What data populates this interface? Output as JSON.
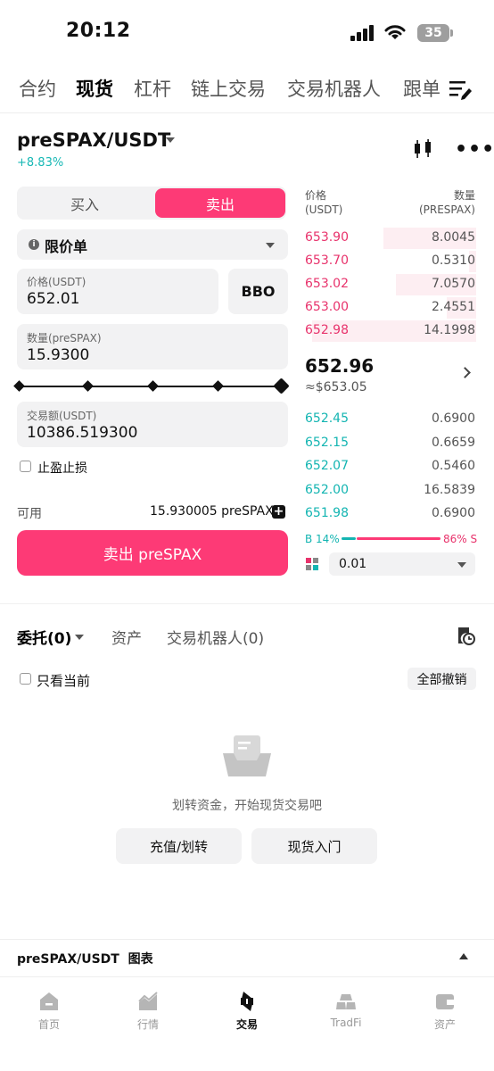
{
  "status": {
    "time": "20:12",
    "battery": "35"
  },
  "top_tabs": [
    "合约",
    "现货",
    "杠杆",
    "链上交易",
    "交易机器人",
    "跟单"
  ],
  "pair": {
    "name": "preSPAX/USDT",
    "change": "+8.83%"
  },
  "toggle": {
    "buy": "买入",
    "sell": "卖出"
  },
  "order_type": "限价单",
  "price_field": {
    "label": "价格(USDT)",
    "value": "652.01",
    "bbo": "BBO"
  },
  "qty_field": {
    "label": "数量(preSPAX)",
    "value": "15.9300"
  },
  "slider_level": 1.0,
  "amount_field": {
    "label": "交易额(USDT)",
    "value": "10386.519300"
  },
  "tpsl_label": "止盈止损",
  "available": {
    "label": "可用",
    "value": "15.930005 preSPAX"
  },
  "sell_button": "卖出 preSPAX",
  "orderbook": {
    "price_header": "价格",
    "price_unit": "(USDT)",
    "qty_header": "数量",
    "qty_unit": "(PRESPAX)",
    "asks": [
      {
        "price": "653.90",
        "qty": "8.0045",
        "depth": 0.54
      },
      {
        "price": "653.70",
        "qty": "0.5310",
        "depth": 0.04
      },
      {
        "price": "653.02",
        "qty": "7.0570",
        "depth": 0.47
      },
      {
        "price": "653.00",
        "qty": "2.4551",
        "depth": 0.17
      },
      {
        "price": "652.98",
        "qty": "14.1998",
        "depth": 0.96
      }
    ],
    "last_price": "652.96",
    "last_usd": "≈$653.05",
    "bids": [
      {
        "price": "652.45",
        "qty": "0.6900"
      },
      {
        "price": "652.15",
        "qty": "0.6659"
      },
      {
        "price": "652.07",
        "qty": "0.5460"
      },
      {
        "price": "652.00",
        "qty": "16.5839"
      },
      {
        "price": "651.98",
        "qty": "0.6900"
      }
    ],
    "ratio_buy": "B 14%",
    "ratio_sell": "86% S",
    "buy_fraction": 0.14,
    "precision": "0.01"
  },
  "bottom_tabs": {
    "orders": "委托(0)",
    "assets": "资产",
    "bots": "交易机器人(0)"
  },
  "only_current": "只看当前",
  "cancel_all": "全部撤销",
  "empty": {
    "text": "划转资金，开始现货交易吧",
    "deposit": "充值/划转",
    "guide": "现货入门"
  },
  "chart_bar": "preSPAX/USDT  图表",
  "nav": [
    "首页",
    "行情",
    "交易",
    "TradFi",
    "资产"
  ],
  "colors": {
    "sell": "#fd3a76",
    "buy": "#14b5b2"
  }
}
